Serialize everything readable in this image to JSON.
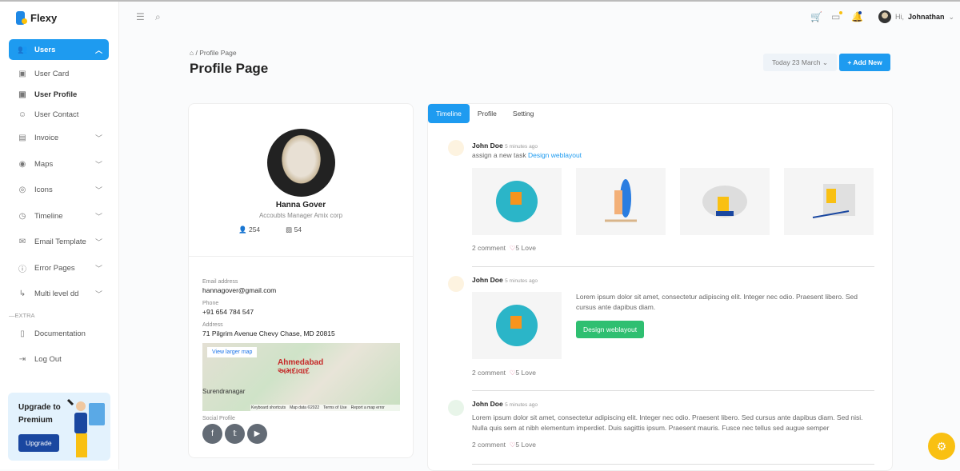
{
  "app": {
    "name": "Flexy"
  },
  "sidebar": {
    "items": [
      {
        "label": "Users",
        "icon": "users-icon"
      },
      {
        "label": "User Card",
        "icon": "card-icon"
      },
      {
        "label": "User Profile",
        "icon": "card-icon"
      },
      {
        "label": "User Contact",
        "icon": "contact-icon"
      },
      {
        "label": "Invoice",
        "icon": "file-icon"
      },
      {
        "label": "Maps",
        "icon": "map-pin-icon"
      },
      {
        "label": "Icons",
        "icon": "target-icon"
      },
      {
        "label": "Timeline",
        "icon": "clock-icon"
      },
      {
        "label": "Email Template",
        "icon": "mail-icon"
      },
      {
        "label": "Error Pages",
        "icon": "alert-icon"
      },
      {
        "label": "Multi level dd",
        "icon": "corner-icon"
      }
    ],
    "extra_label": "EXTRA",
    "extra": [
      {
        "label": "Documentation"
      },
      {
        "label": "Log Out"
      }
    ],
    "upgrade": {
      "title": "Upgrade to Premium",
      "button": "Upgrade"
    }
  },
  "header": {
    "greeting": "Hi,",
    "username": "Johnathan",
    "accent": "#1e9bf0"
  },
  "page": {
    "breadcrumb": "Profile Page",
    "title": "Profile Page",
    "date": "Today 23 March",
    "add": "+ Add New"
  },
  "profile": {
    "name": "Hanna Gover",
    "role": "Accoubts Manager Amix corp",
    "followers": "254",
    "photos": "54",
    "email_label": "Email address",
    "email": "hannagover@gmail.com",
    "phone_label": "Phone",
    "phone": "+91 654 784 547",
    "address_label": "Address",
    "address": "71 Pilgrim Avenue Chevy Chase, MD 20815",
    "map": {
      "button": "View larger map",
      "city": "Ahmedabad",
      "city_local": "અમદાવાદ",
      "city2": "Surendranagar",
      "footer": [
        "Keyboard shortcuts",
        "Map data ©2022",
        "Terms of Use",
        "Report a map error"
      ]
    },
    "social_label": "Social Profile"
  },
  "tabs": [
    "Timeline",
    "Profile",
    "Setting"
  ],
  "timeline": [
    {
      "name": "John Doe",
      "time": "5 minutes ago",
      "text": "assign a new task",
      "link": "Design weblayout",
      "comments": "2 comment",
      "love": "5 Love"
    },
    {
      "name": "John Doe",
      "time": "5 minutes ago",
      "text": "Lorem ipsum dolor sit amet, consectetur adipiscing elit. Integer nec odio. Praesent libero. Sed cursus ante dapibus diam.",
      "button": "Design weblayout",
      "comments": "2 comment",
      "love": "5 Love"
    },
    {
      "name": "John Doe",
      "time": "5 minutes ago",
      "text": "Lorem ipsum dolor sit amet, consectetur adipiscing elit. Integer nec odio. Praesent libero. Sed cursus ante dapibus diam. Sed nisi. Nulla quis sem at nibh elementum imperdiet. Duis sagittis ipsum. Praesent mauris. Fusce nec tellus sed augue semper",
      "comments": "2 comment",
      "love": "5 Love"
    }
  ]
}
